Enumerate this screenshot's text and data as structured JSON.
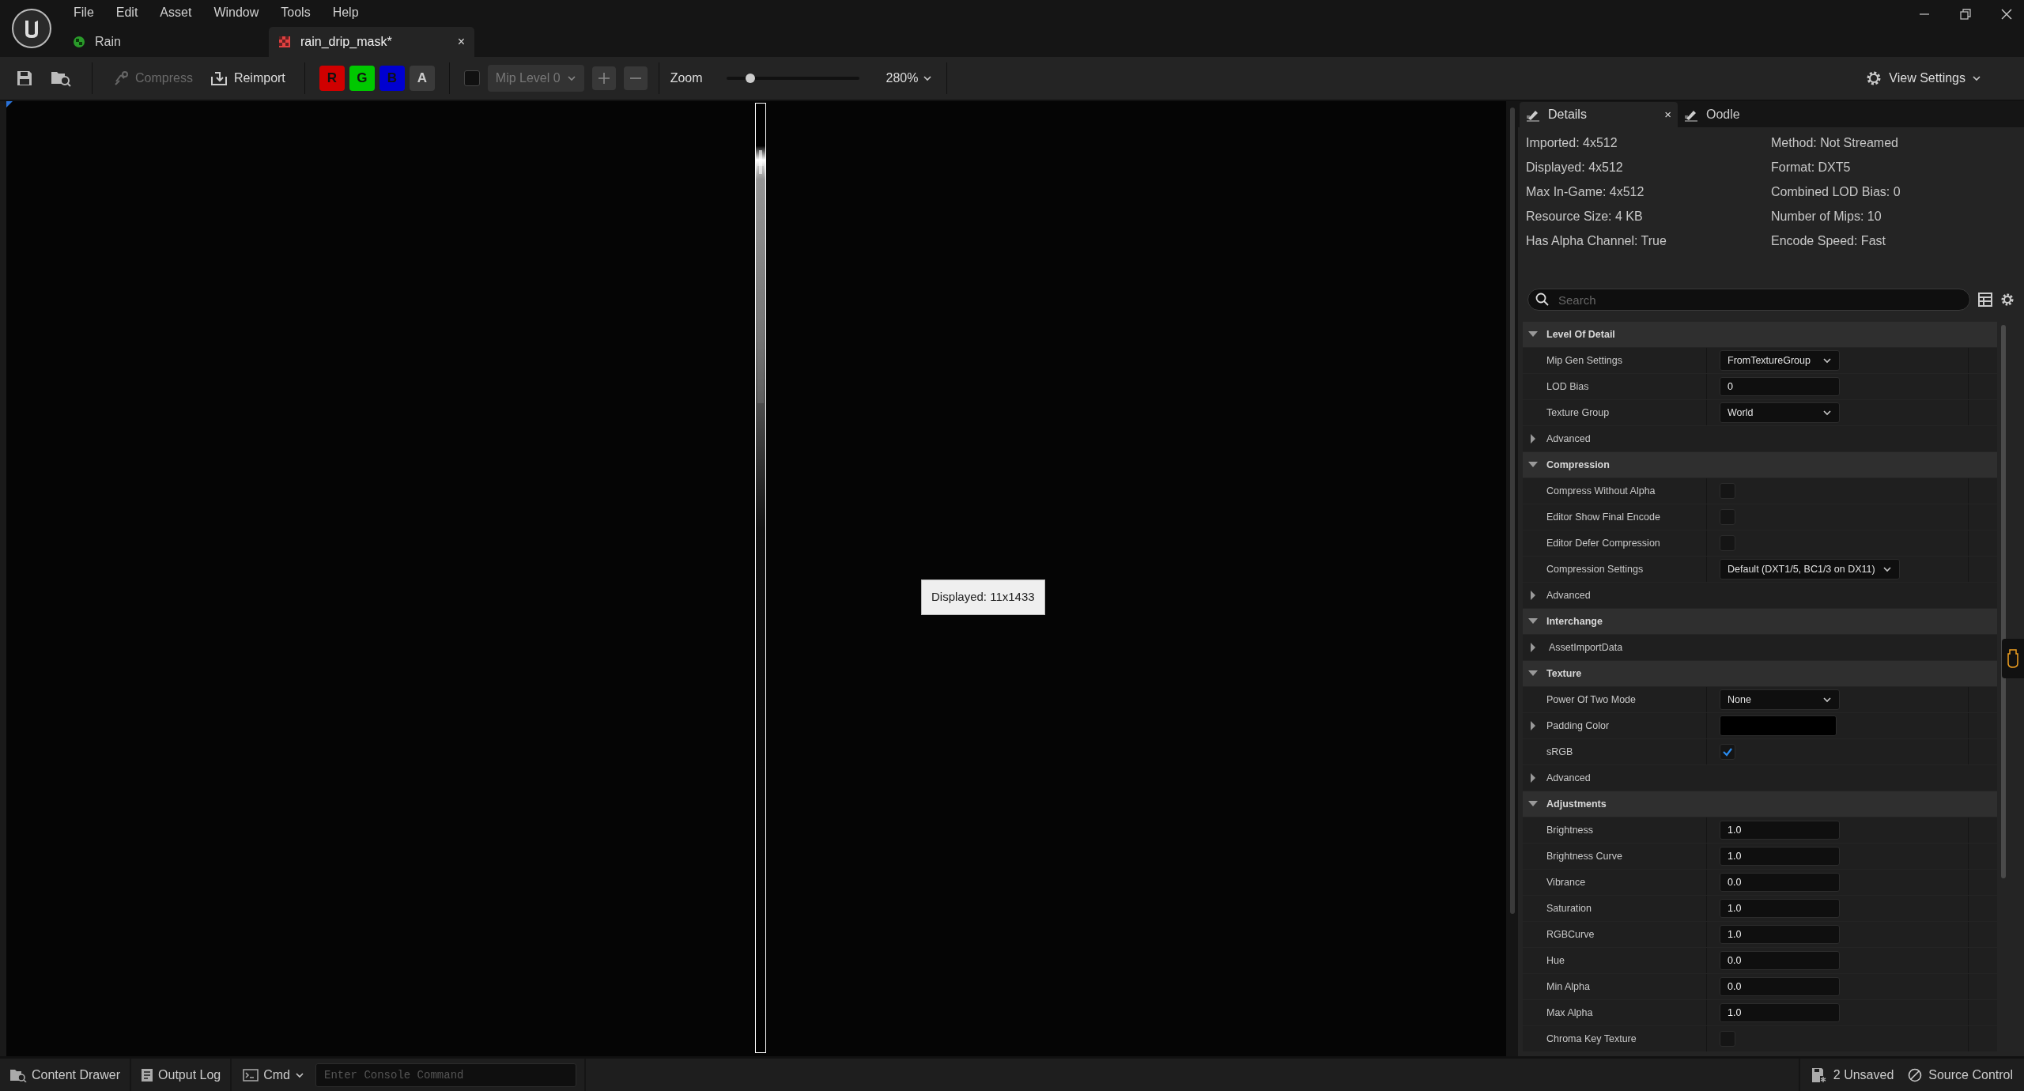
{
  "menu": [
    "File",
    "Edit",
    "Asset",
    "Window",
    "Tools",
    "Help"
  ],
  "doc_tabs": [
    {
      "label": "Rain",
      "selected": false,
      "kind": "level"
    },
    {
      "label": "rain_drip_mask*",
      "selected": true,
      "kind": "texture",
      "close": "×"
    }
  ],
  "toolbar": {
    "compress": {
      "label": "Compress",
      "disabled": true
    },
    "reimport": {
      "label": "Reimport"
    },
    "channels": [
      {
        "label": "R",
        "color": "#d00000"
      },
      {
        "label": "G",
        "color": "#00c800"
      },
      {
        "label": "B",
        "color": "#0000d0"
      },
      {
        "label": "A",
        "color": "#3a3a3a"
      }
    ],
    "mip_checkbox": {
      "checked": false
    },
    "mip_level": {
      "value": "Mip Level 0",
      "disabled": true
    },
    "zoom_label": "Zoom",
    "zoom": {
      "level": 0.18
    },
    "zoom_value": "280%",
    "view_settings": "View Settings"
  },
  "viewport": {
    "tooltip": "Displayed: 11x1433"
  },
  "details": {
    "tabs": [
      {
        "label": "Details",
        "selected": true,
        "close": "×"
      },
      {
        "label": "Oodle",
        "selected": false
      }
    ],
    "info_left": [
      "Imported: 4x512",
      "Displayed: 4x512",
      "Max In-Game: 4x512",
      "Resource Size: 4 KB",
      "Has Alpha Channel: True"
    ],
    "info_right": [
      "Method: Not Streamed",
      "Format: DXT5",
      "Combined LOD Bias: 0",
      "Number of Mips: 10",
      "Encode Speed: Fast"
    ],
    "search": {
      "placeholder": "Search"
    },
    "sections": [
      {
        "title": "Level Of Detail",
        "expanded": true,
        "rows": [
          {
            "kind": "dropdown",
            "label": "Mip Gen Settings",
            "value": "FromTextureGroup"
          },
          {
            "kind": "number",
            "label": "LOD Bias",
            "value": "0"
          },
          {
            "kind": "dropdown",
            "label": "Texture Group",
            "value": "World"
          },
          {
            "kind": "group",
            "label": "Advanced",
            "expanded": false
          }
        ]
      },
      {
        "title": "Compression",
        "expanded": true,
        "rows": [
          {
            "kind": "checkbox",
            "label": "Compress Without Alpha",
            "checked": false
          },
          {
            "kind": "checkbox",
            "label": "Editor Show Final Encode",
            "checked": false
          },
          {
            "kind": "checkbox",
            "label": "Editor Defer Compression",
            "checked": false
          },
          {
            "kind": "dropdown",
            "label": "Compression Settings",
            "value": "Default (DXT1/5, BC1/3 on DX11)",
            "wide": true
          },
          {
            "kind": "group",
            "label": "Advanced",
            "expanded": false
          }
        ]
      },
      {
        "title": "Interchange",
        "expanded": true,
        "rows": [
          {
            "kind": "group",
            "label": "AssetImportData",
            "expanded": false
          }
        ]
      },
      {
        "title": "Texture",
        "expanded": true,
        "rows": [
          {
            "kind": "dropdown",
            "label": "Power Of Two Mode",
            "value": "None"
          },
          {
            "kind": "color",
            "label": "Padding Color",
            "expanded": false,
            "color": "#000000"
          },
          {
            "kind": "checkbox",
            "label": "sRGB",
            "checked": true
          },
          {
            "kind": "group",
            "label": "Advanced",
            "expanded": false
          }
        ]
      },
      {
        "title": "Adjustments",
        "expanded": true,
        "rows": [
          {
            "kind": "number",
            "label": "Brightness",
            "value": "1.0"
          },
          {
            "kind": "number",
            "label": "Brightness Curve",
            "value": "1.0"
          },
          {
            "kind": "number",
            "label": "Vibrance",
            "value": "0.0"
          },
          {
            "kind": "number",
            "label": "Saturation",
            "value": "1.0"
          },
          {
            "kind": "number",
            "label": "RGBCurve",
            "value": "1.0"
          },
          {
            "kind": "number",
            "label": "Hue",
            "value": "0.0"
          },
          {
            "kind": "number",
            "label": "Min Alpha",
            "value": "0.0"
          },
          {
            "kind": "number",
            "label": "Max Alpha",
            "value": "1.0"
          },
          {
            "kind": "checkbox",
            "label": "Chroma Key Texture",
            "checked": false
          }
        ]
      }
    ]
  },
  "status_bar": {
    "content_drawer": "Content Drawer",
    "output_log": "Output Log",
    "cmd": "Cmd",
    "console": {
      "placeholder": "Enter Console Command"
    },
    "unsaved": "2 Unsaved",
    "source_control": "Source Control"
  }
}
